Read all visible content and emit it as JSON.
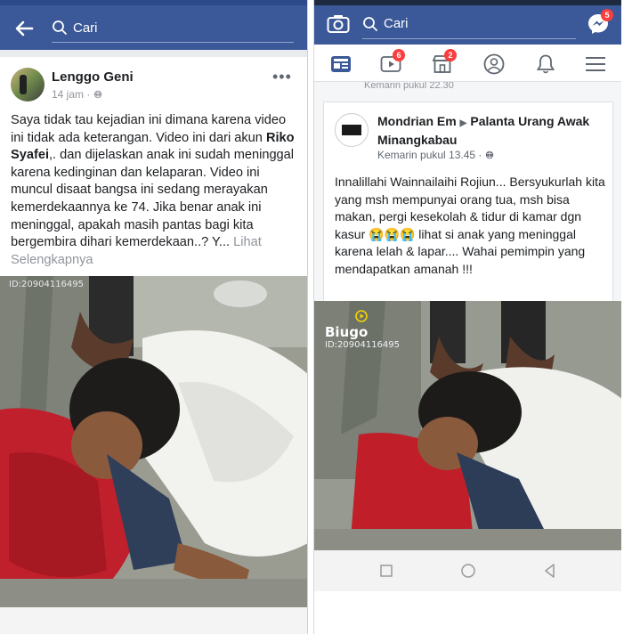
{
  "left": {
    "search_placeholder": "Cari",
    "post": {
      "author": "Lenggo Geni",
      "time": "14 jam",
      "meta_separator": "·",
      "text_part1": "Saya tidak tau kejadian ini dimana karena video ini tidak ada keterangan. Video ini dari akun ",
      "text_mention": "Riko Syafei",
      "text_part2": ",. dan dijelaskan anak ini sudah meninggal karena kedinginan dan kelaparan. Video ini muncul disaat bangsa ini sedang merayakan kemerdekaannya ke 74. Jika benar anak ini meninggal, apakah masih pantas bagi kita bergembira dihari kemerdekaan..? Y...",
      "see_more": "Lihat Selengkapnya",
      "photo_watermark": "ID:20904116495"
    }
  },
  "right": {
    "search_placeholder": "Cari",
    "messenger_badge": "5",
    "tabs": [
      {
        "name": "news-feed",
        "badge": ""
      },
      {
        "name": "watch",
        "badge": "6"
      },
      {
        "name": "marketplace",
        "badge": "2"
      },
      {
        "name": "profile",
        "badge": ""
      },
      {
        "name": "notifications",
        "badge": ""
      },
      {
        "name": "menu",
        "badge": ""
      }
    ],
    "previous_meta": "Kemarin pukul 22.30",
    "post": {
      "author": "Mondrian Em",
      "group": "Palanta Urang Awak Minangkabau",
      "time": "Kemarin pukul 13.45",
      "meta_separator": "·",
      "text": "Innalillahi Wainnailaihi Rojiun... Bersyukurlah kita yang msh mempunyai orang tua,  msh bisa makan,  pergi kesekolah & tidur di kamar dgn kasur 😭😭😭 lihat si anak yang meninggal karena lelah & lapar....  Wahai pemimpin yang mendapatkan amanah !!!",
      "photo_logo": "Biugo",
      "photo_watermark": "ID:20904116495"
    }
  },
  "colors": {
    "facebook_blue": "#3b5998",
    "badge_red": "#fa3e3e",
    "muted_text": "#90949c"
  }
}
